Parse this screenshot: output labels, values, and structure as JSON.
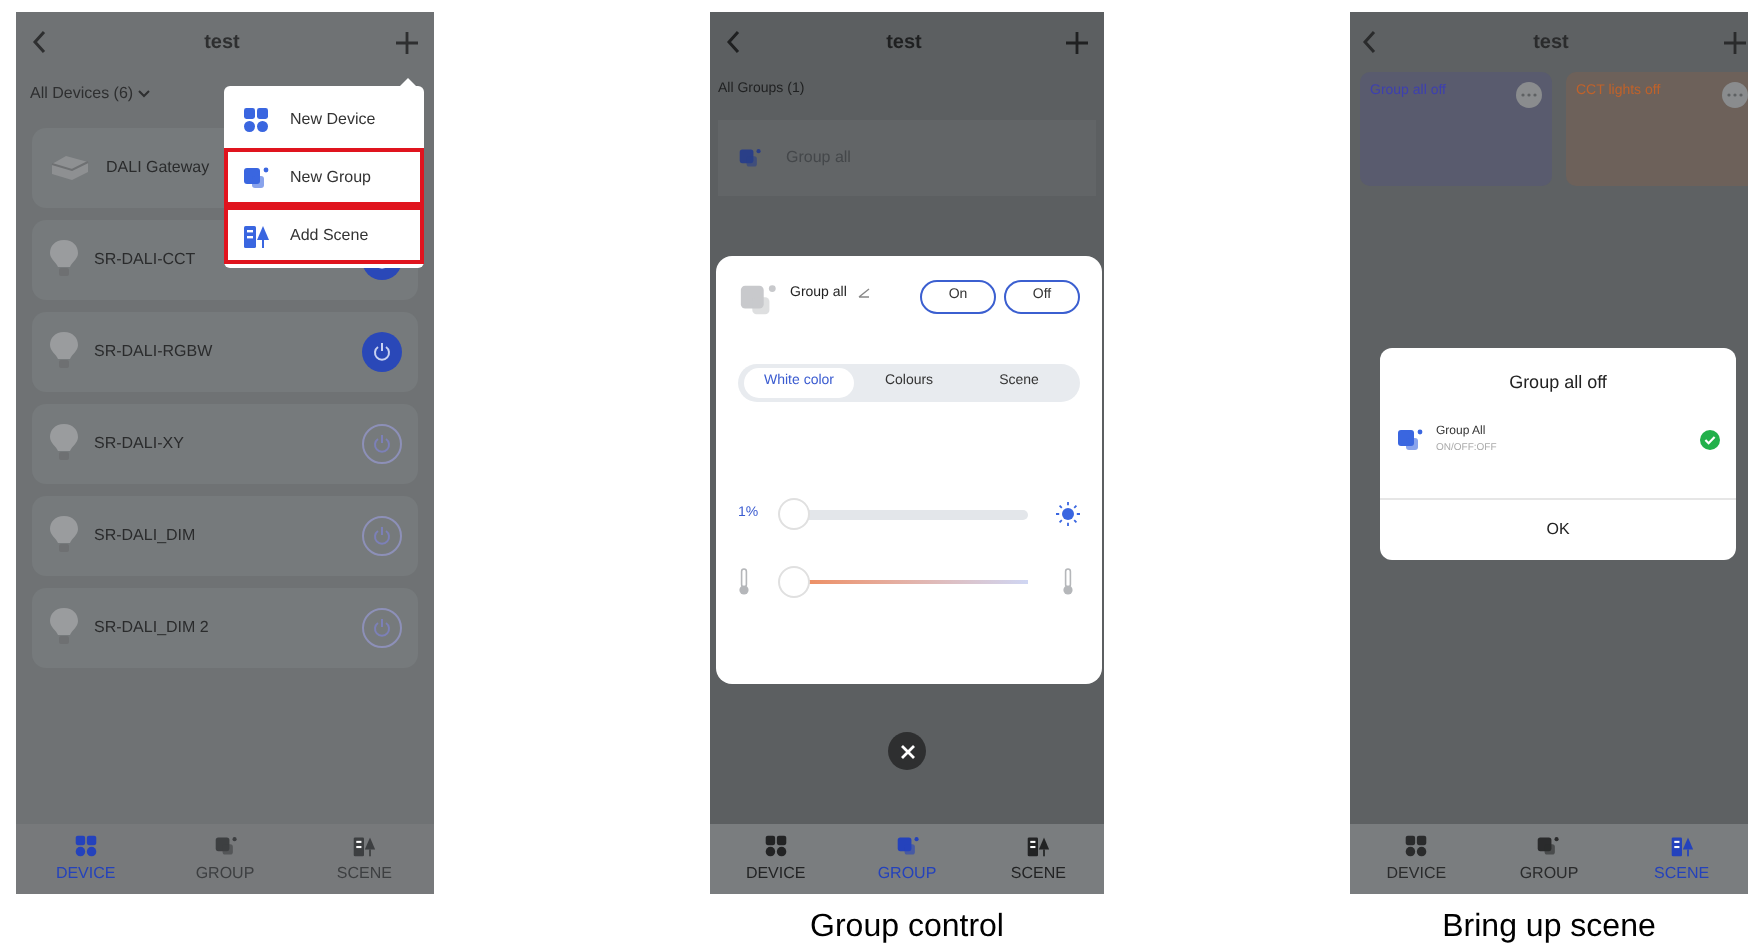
{
  "phones": [
    {
      "kind": "devices",
      "title": "test",
      "filter": "All Devices (6)",
      "devices": [
        {
          "name": "DALI Gateway",
          "kind": "gateway"
        },
        {
          "name": "SR-DALI-CCT",
          "kind": "bulb",
          "on": true
        },
        {
          "name": "SR-DALI-RGBW",
          "kind": "bulb",
          "on": true
        },
        {
          "name": "SR-DALI-XY",
          "kind": "bulb",
          "on": false
        },
        {
          "name": "SR-DALI_DIM",
          "kind": "bulb",
          "on": false
        },
        {
          "name": "SR-DALI_DIM 2",
          "kind": "bulb",
          "on": false
        }
      ],
      "menu": [
        {
          "label": "New Device",
          "kind": "device",
          "highlighted": false
        },
        {
          "label": "New Group",
          "kind": "group",
          "highlighted": true
        },
        {
          "label": "Add Scene",
          "kind": "scene",
          "highlighted": true
        }
      ],
      "tabs": [
        {
          "label": "DEVICE",
          "kind": "device",
          "selected": true
        },
        {
          "label": "GROUP",
          "kind": "group",
          "selected": false
        },
        {
          "label": "SCENE",
          "kind": "scene",
          "selected": false
        }
      ]
    },
    {
      "kind": "group_control",
      "title": "test",
      "filter": "All Groups (1)",
      "groups": [
        "Group all"
      ],
      "panel": {
        "name": "Group all",
        "buttons": [
          "On",
          "Off"
        ],
        "segments": [
          {
            "label": "White color",
            "selected": true
          },
          {
            "label": "Colours",
            "selected": false
          },
          {
            "label": "Scene",
            "selected": false
          }
        ],
        "brightness": {
          "reading": "1%",
          "level": 0.0
        },
        "temperature": {
          "level": 0.0
        }
      },
      "tabs": [
        {
          "label": "DEVICE",
          "kind": "device",
          "selected": false
        },
        {
          "label": "GROUP",
          "kind": "group",
          "selected": true
        },
        {
          "label": "SCENE",
          "kind": "scene",
          "selected": false
        }
      ],
      "caption": "Group control"
    },
    {
      "kind": "scenes",
      "title": "test",
      "scenes": [
        {
          "name": "Group all off",
          "color": "#3d3fb0"
        },
        {
          "name": "CCT lights off",
          "color": "#c0622a"
        }
      ],
      "dialog": {
        "title": "Group all off",
        "items": [
          {
            "name": "Group All",
            "detail": "ON/OFF:OFF",
            "checked": true
          }
        ],
        "button": "OK"
      },
      "tabs": [
        {
          "label": "DEVICE",
          "kind": "device",
          "selected": false
        },
        {
          "label": "GROUP",
          "kind": "group",
          "selected": false
        },
        {
          "label": "SCENE",
          "kind": "scene",
          "selected": true
        }
      ],
      "caption": "Bring up scene"
    }
  ]
}
